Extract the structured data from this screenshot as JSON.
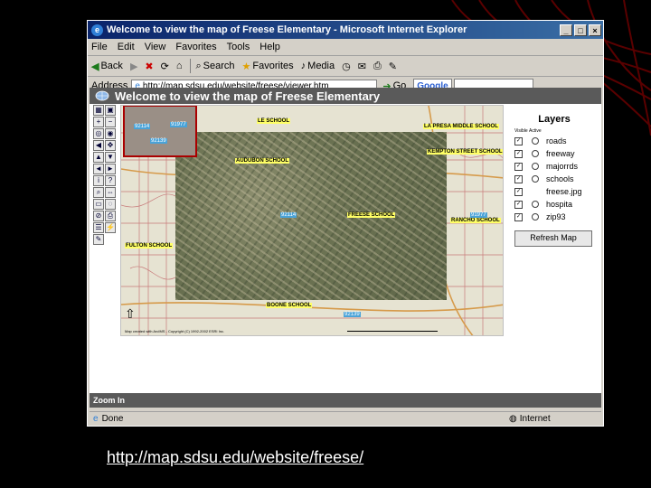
{
  "window": {
    "title": "Welcome to view the map of Freese Elementary - Microsoft Internet Explorer",
    "controls": [
      "_",
      "□",
      "×"
    ]
  },
  "menu": [
    "File",
    "Edit",
    "View",
    "Favorites",
    "Tools",
    "Help"
  ],
  "toolbar": {
    "back": "Back",
    "search": "Search",
    "favorites": "Favorites",
    "media": "Media"
  },
  "address": {
    "label": "Address",
    "url": "http://map.sdsu.edu/website/freese/viewer.htm",
    "go": "Go",
    "google": "Google"
  },
  "map_page": {
    "header": "Welcome to view the map of Freese Elementary",
    "footer": "Zoom In",
    "labels": {
      "le_school": "LE SCHOOL",
      "la_presa": "LA PRESA MIDDLE SCHOOL",
      "kempton": "KEMPTON STREET SCHOOL",
      "audubon": "AUDUBON SCHOOL",
      "freese": "FREESE SCHOOL",
      "rancho": "RANCHO SCHOOL",
      "fulton": "FULTON SCHOOL",
      "boone": "BOONE SCHOOL"
    },
    "zips": {
      "z1": "92114",
      "z2": "91977",
      "z3": "92139",
      "z4": "92114",
      "z5": "91977",
      "z6": "92139"
    },
    "copyright": "Map created with ArcIMS - Copyright (C) 1992-2002 ESRI Inc."
  },
  "layers": {
    "title": "Layers",
    "visible_label": "Visible",
    "active_label": "Active",
    "items": [
      {
        "name": "roads"
      },
      {
        "name": "freeway"
      },
      {
        "name": "majorrds"
      },
      {
        "name": "schools"
      },
      {
        "name": "freese.jpg"
      },
      {
        "name": "hospita"
      },
      {
        "name": "zip93"
      }
    ],
    "refresh": "Refresh Map"
  },
  "status": {
    "left": "Done",
    "right": "Internet"
  },
  "caption": "http://map.sdsu.edu/website/freese/",
  "colors": {
    "titlebar": "#0a246a",
    "map_header": "#5a5a5a",
    "school_label": "#ffff66",
    "zip_label": "#4aa3d8"
  }
}
